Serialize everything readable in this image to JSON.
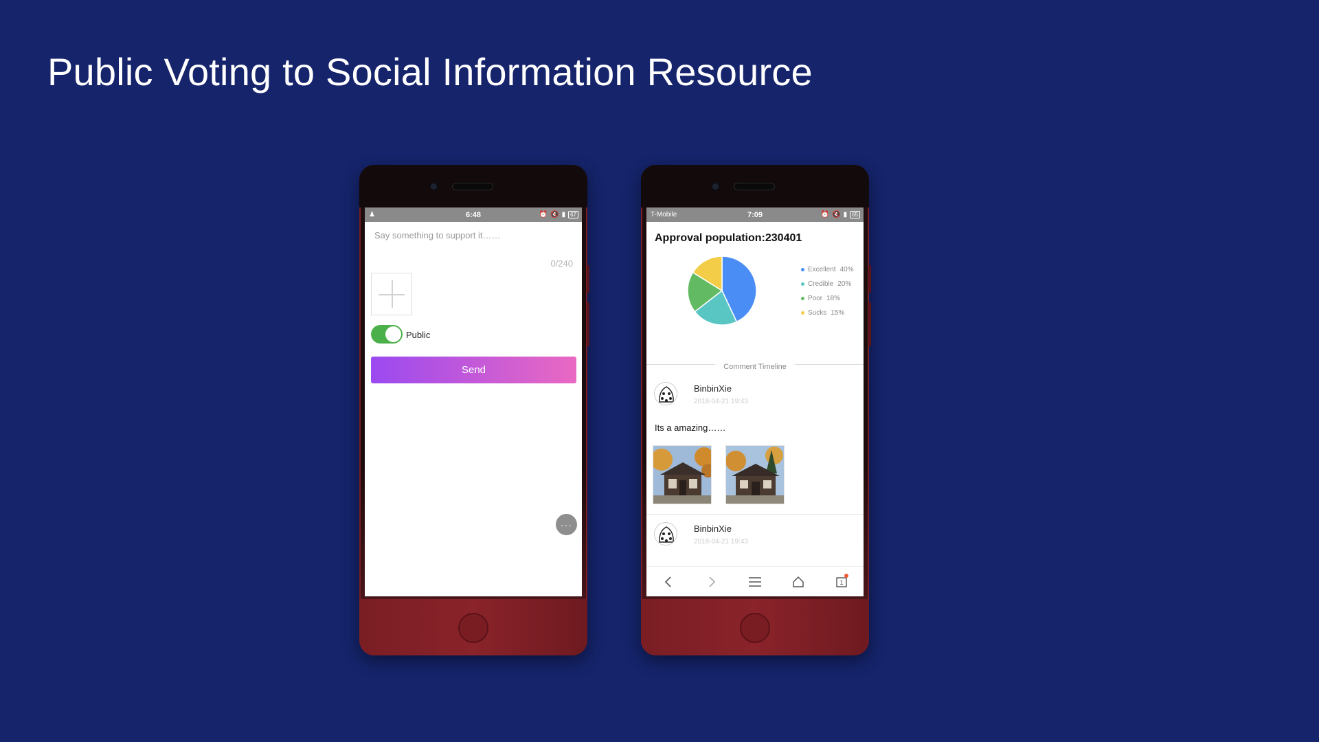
{
  "slide": {
    "title": "Public Voting to Social Information Resource"
  },
  "left_phone": {
    "status_bar": {
      "time": "6:48",
      "battery": "67"
    },
    "support_placeholder": "Say something to support it……",
    "char_counter": "0/240",
    "public_toggle": {
      "label": "Public",
      "on": true
    },
    "send_label": "Send",
    "more_button": "···",
    "colors": {
      "toggle_on": "#4cb04a",
      "send_gradient_start": "#9b49f0",
      "send_gradient_end": "#ea69c2"
    }
  },
  "right_phone": {
    "status_bar": {
      "carrier": "T-Mobile",
      "time": "7:09",
      "battery": "65"
    },
    "approval_title": "Approval population:230401",
    "timeline_label": "Comment Timeline",
    "comments": [
      {
        "user": "BinbinXie",
        "time": "2018-04-21 19:43",
        "text": "Its a amazing……",
        "photos": 2
      },
      {
        "user": "BinbinXie",
        "time": "2018-04-21 19:43"
      }
    ],
    "nav": {
      "icons": [
        "back-icon",
        "forward-icon",
        "menu-icon",
        "home-icon",
        "tabs-icon"
      ],
      "tab_count": "1"
    }
  },
  "chart_data": {
    "type": "pie",
    "slices": [
      {
        "label": "Excellent",
        "value": 40,
        "pct": "40%",
        "color": "#4a8ef5"
      },
      {
        "label": "Credible",
        "value": 20,
        "pct": "20%",
        "color": "#5ac6c3"
      },
      {
        "label": "Poor",
        "value": 18,
        "pct": "18%",
        "color": "#62bb62"
      },
      {
        "label": "Sucks",
        "value": 15,
        "pct": "15%",
        "color": "#f3cc48"
      }
    ],
    "legend_position": "right"
  }
}
